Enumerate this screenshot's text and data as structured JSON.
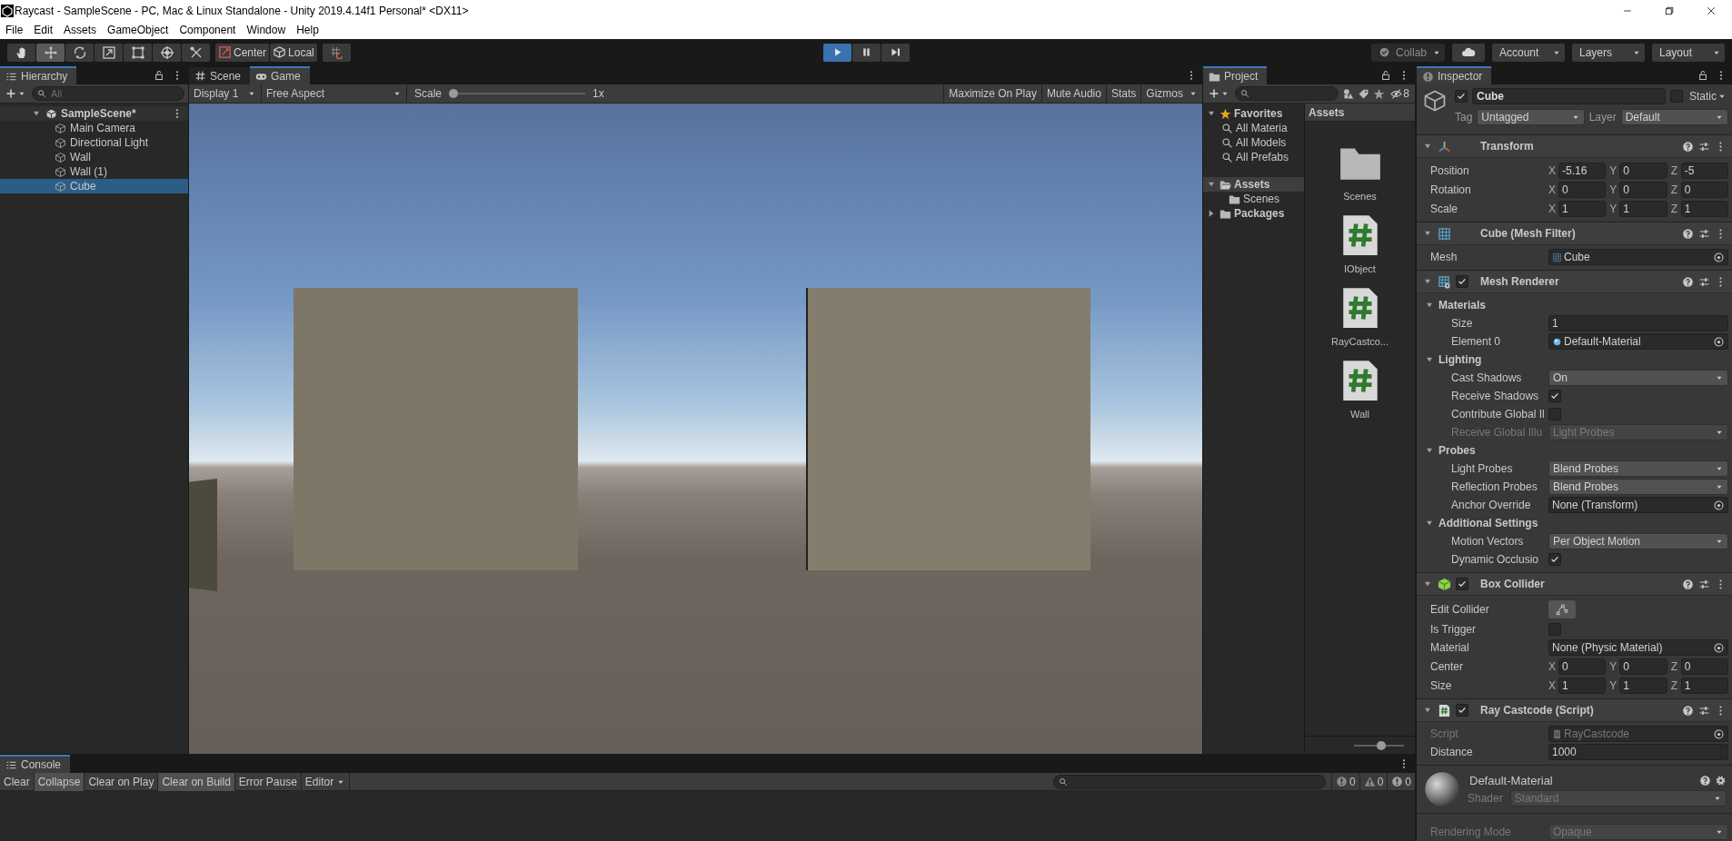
{
  "window": {
    "title": "Raycast - SampleScene - PC, Mac & Linux Standalone - Unity 2019.4.14f1 Personal* <DX11>"
  },
  "menu": [
    "File",
    "Edit",
    "Assets",
    "GameObject",
    "Component",
    "Window",
    "Help"
  ],
  "toolbar": {
    "tools": [
      {
        "kind": "hand",
        "selected": false
      },
      {
        "kind": "move",
        "selected": true
      },
      {
        "kind": "rotate",
        "selected": false
      },
      {
        "kind": "scale",
        "selected": false
      },
      {
        "kind": "rect",
        "selected": false
      },
      {
        "kind": "transform",
        "selected": false
      },
      {
        "kind": "custom",
        "selected": false
      }
    ],
    "pivot": [
      {
        "kind": "center",
        "label": "Center"
      },
      {
        "kind": "local",
        "label": "Local"
      }
    ],
    "playback": [
      {
        "kind": "play",
        "on": true
      },
      {
        "kind": "pause",
        "on": false
      },
      {
        "kind": "step",
        "on": false
      }
    ],
    "collab": "Collab",
    "account": "Account",
    "layers": "Layers",
    "layout": "Layout"
  },
  "hierarchy": {
    "title": "Hierarchy",
    "search_placeholder": "All",
    "scene": {
      "name": "SampleScene*",
      "expanded": true,
      "children": [
        {
          "name": "Main Camera",
          "selected": false
        },
        {
          "name": "Directional Light",
          "selected": false
        },
        {
          "name": "Wall",
          "selected": false
        },
        {
          "name": "Wall (1)",
          "selected": false
        },
        {
          "name": "Cube",
          "selected": true
        }
      ]
    }
  },
  "view_tabs": [
    {
      "label": "Scene",
      "kind": "scene",
      "selected": false
    },
    {
      "label": "Game",
      "kind": "game",
      "selected": true
    }
  ],
  "game_toolbar": {
    "display": "Display 1",
    "aspect": "Free Aspect",
    "scale_label": "Scale",
    "scale": {
      "level": 0.0
    },
    "scale_value": "1x",
    "toggles": [
      {
        "label": "Maximize On Play",
        "on": false
      },
      {
        "label": "Mute Audio",
        "on": false
      },
      {
        "label": "Stats",
        "on": false
      }
    ],
    "gizmos": "Gizmos"
  },
  "project": {
    "title": "Project",
    "hidden_count": "8",
    "tree": [
      {
        "label": "Favorites",
        "kind": "favorites",
        "expanded": true,
        "selected": false,
        "children": [
          {
            "label": "All Materia",
            "kind": "search",
            "selected": false
          },
          {
            "label": "All Models",
            "kind": "search",
            "selected": false
          },
          {
            "label": "All Prefabs",
            "kind": "search",
            "selected": false
          }
        ]
      },
      {
        "label": "Assets",
        "kind": "folder",
        "expanded": true,
        "selected": true,
        "children": [
          {
            "label": "Scenes",
            "kind": "folder",
            "selected": false
          }
        ]
      },
      {
        "label": "Packages",
        "kind": "folder",
        "expanded": false,
        "selected": false
      }
    ],
    "breadcrumb": "Assets",
    "items": [
      {
        "label": "Scenes",
        "kind": "folder"
      },
      {
        "label": "IObject",
        "kind": "script"
      },
      {
        "label": "RayCastco...",
        "kind": "script"
      },
      {
        "label": "Wall",
        "kind": "script"
      }
    ],
    "icon_size": {
      "level": 0.55
    }
  },
  "inspector": {
    "title": "Inspector",
    "object": {
      "active": true,
      "name": "Cube",
      "static": false,
      "static_label": "Static",
      "tag_label": "Tag",
      "tag": "Untagged",
      "layer_label": "Layer",
      "layer": "Default"
    },
    "components": [
      {
        "kind": "transform",
        "title": "Transform",
        "expanded": true,
        "fields": [
          {
            "kind": "vector3",
            "label": "Position",
            "values": [
              {
                "axis": "X",
                "value": "-5.16"
              },
              {
                "axis": "Y",
                "value": "0"
              },
              {
                "axis": "Z",
                "value": "-5"
              }
            ]
          },
          {
            "kind": "vector3",
            "label": "Rotation",
            "values": [
              {
                "axis": "X",
                "value": "0"
              },
              {
                "axis": "Y",
                "value": "0"
              },
              {
                "axis": "Z",
                "value": "0"
              }
            ]
          },
          {
            "kind": "vector3",
            "label": "Scale",
            "values": [
              {
                "axis": "X",
                "value": "1"
              },
              {
                "axis": "Y",
                "value": "1"
              },
              {
                "axis": "Z",
                "value": "1"
              }
            ]
          }
        ]
      },
      {
        "kind": "mesh_filter",
        "title": "Cube (Mesh Filter)",
        "expanded": true,
        "fields": [
          {
            "kind": "mesh_object",
            "label": "Mesh",
            "value": "Cube",
            "disabled": false
          }
        ]
      },
      {
        "kind": "mesh_renderer",
        "title": "Mesh Renderer",
        "enabled": true,
        "expanded": true,
        "fields": [
          {
            "kind": "section",
            "label": "Materials",
            "expanded": true,
            "children": [
              {
                "kind": "text",
                "label": "Size",
                "value": "1",
                "disabled": false
              },
              {
                "kind": "material_object",
                "label": "Element 0",
                "value": "Default-Material",
                "disabled": false
              }
            ]
          },
          {
            "kind": "section",
            "label": "Lighting",
            "expanded": true,
            "children": [
              {
                "kind": "dropdown",
                "label": "Cast Shadows",
                "value": "On",
                "disabled": false
              },
              {
                "kind": "checkbox",
                "label": "Receive Shadows",
                "checked": true,
                "disabled": false
              },
              {
                "kind": "checkbox",
                "label": "Contribute Global Il",
                "checked": false,
                "disabled": false
              },
              {
                "kind": "dropdown",
                "label": "Receive Global Illu",
                "value": "Light Probes",
                "disabled": true
              }
            ]
          },
          {
            "kind": "section",
            "label": "Probes",
            "expanded": true,
            "children": [
              {
                "kind": "dropdown",
                "label": "Light Probes",
                "value": "Blend Probes",
                "disabled": false
              },
              {
                "kind": "dropdown",
                "label": "Reflection Probes",
                "value": "Blend Probes",
                "disabled": false
              },
              {
                "kind": "object",
                "label": "Anchor Override",
                "value": "None (Transform)",
                "disabled": false
              }
            ]
          },
          {
            "kind": "section",
            "label": "Additional Settings",
            "expanded": true,
            "children": [
              {
                "kind": "dropdown",
                "label": "Motion Vectors",
                "value": "Per Object Motion",
                "disabled": false
              },
              {
                "kind": "checkbox",
                "label": "Dynamic Occlusio",
                "checked": true,
                "disabled": false
              }
            ]
          }
        ]
      },
      {
        "kind": "box_collider",
        "title": "Box Collider",
        "enabled": true,
        "expanded": true,
        "fields": [
          {
            "kind": "button",
            "label": "Edit Collider",
            "disabled": false
          },
          {
            "kind": "checkbox",
            "label": "Is Trigger",
            "checked": false,
            "disabled": false
          },
          {
            "kind": "object",
            "label": "Material",
            "value": "None (Physic Material)",
            "disabled": false
          },
          {
            "kind": "vector3",
            "label": "Center",
            "values": [
              {
                "axis": "X",
                "value": "0"
              },
              {
                "axis": "Y",
                "value": "0"
              },
              {
                "axis": "Z",
                "value": "0"
              }
            ]
          },
          {
            "kind": "vector3",
            "label": "Size",
            "values": [
              {
                "axis": "X",
                "value": "1"
              },
              {
                "axis": "Y",
                "value": "1"
              },
              {
                "axis": "Z",
                "value": "1"
              }
            ]
          }
        ]
      },
      {
        "kind": "script",
        "title": "Ray Castcode (Script)",
        "enabled": true,
        "expanded": true,
        "fields": [
          {
            "kind": "script_object",
            "label": "Script",
            "value": "RayCastcode",
            "disabled": true
          },
          {
            "kind": "text",
            "label": "Distance",
            "value": "1000",
            "disabled": false
          }
        ]
      }
    ],
    "material": {
      "name": "Default-Material",
      "shader_label": "Shader",
      "shader": "Standard",
      "fields": [
        {
          "kind": "dropdown",
          "label": "Rendering Mode",
          "value": "Opaque",
          "disabled": true
        }
      ]
    }
  },
  "console": {
    "title": "Console",
    "buttons": [
      {
        "label": "Clear",
        "on": false
      },
      {
        "label": "Collapse",
        "on": true
      },
      {
        "label": "Clear on Play",
        "on": false
      },
      {
        "label": "Clear on Build",
        "on": true
      },
      {
        "label": "Error Pause",
        "on": false
      }
    ],
    "editor": "Editor",
    "counts": [
      {
        "kind": "log",
        "count": "0"
      },
      {
        "kind": "warning",
        "count": "0"
      },
      {
        "kind": "error",
        "count": "0"
      }
    ]
  }
}
